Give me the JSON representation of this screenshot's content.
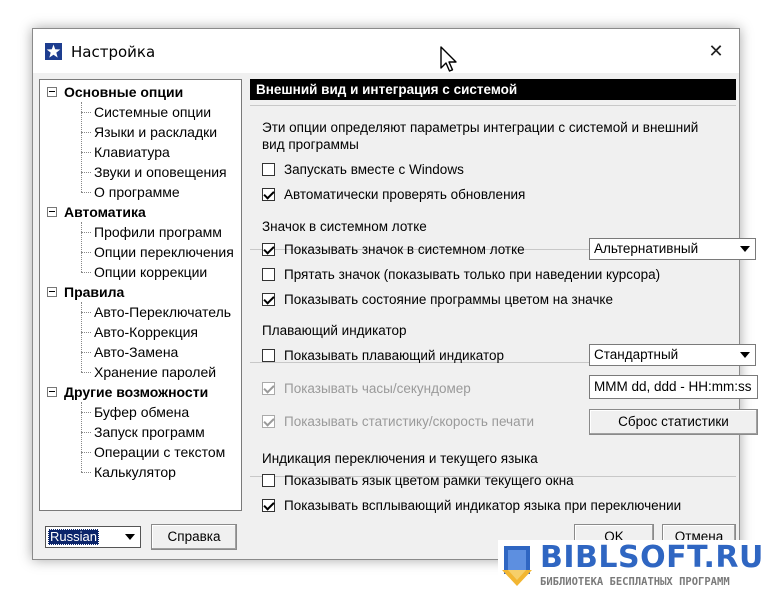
{
  "window": {
    "title": "Настройка",
    "close_glyph": "✕"
  },
  "tree": {
    "groups": [
      {
        "label": "Основные опции",
        "items": [
          "Системные опции",
          "Языки и раскладки",
          "Клавиатура",
          "Звуки и оповещения",
          "О программе"
        ]
      },
      {
        "label": "Автоматика",
        "items": [
          "Профили программ",
          "Опции переключения",
          "Опции коррекции"
        ]
      },
      {
        "label": "Правила",
        "items": [
          "Авто-Переключатель",
          "Авто-Коррекция",
          "Авто-Замена",
          "Хранение паролей"
        ]
      },
      {
        "label": "Другие возможности",
        "items": [
          "Буфер обмена",
          "Запуск программ",
          "Операции с текстом",
          "Калькулятор"
        ]
      }
    ]
  },
  "panel": {
    "header": "Внешний вид и интеграция с системой",
    "description": "Эти опции определяют параметры интеграции с системой и внешний вид программы",
    "general": {
      "start_with_windows": {
        "label": "Запускать вместе с Windows",
        "checked": false
      },
      "auto_update": {
        "label": "Автоматически проверять обновления",
        "checked": true
      }
    },
    "tray": {
      "title": "Значок в системном лотке",
      "show_icon": {
        "label": "Показывать значок в системном лотке",
        "checked": true
      },
      "icon_style": "Альтернативный",
      "hide_icon": {
        "label": "Прятать значок (показывать только при наведении курсора)",
        "checked": false
      },
      "show_state": {
        "label": "Показывать состояние программы цветом на значке",
        "checked": true
      }
    },
    "floating": {
      "title": "Плавающий индикатор",
      "show_indicator": {
        "label": "Показывать плавающий индикатор",
        "checked": false
      },
      "indicator_style": "Стандартный",
      "show_clock": {
        "label": "Показывать часы/секундомер",
        "checked": true
      },
      "clock_format": "MMM dd, ddd - HH:mm:ss",
      "show_stats": {
        "label": "Показывать статистику/скорость печати",
        "checked": true
      },
      "reset_stats_label": "Сброс статистики"
    },
    "lang_indication": {
      "title": "Индикация переключения и текущего языка",
      "frame_color": {
        "label": "Показывать язык цветом рамки текущего окна",
        "checked": false
      },
      "popup": {
        "label": "Показывать всплывающий индикатор языка при переключении",
        "checked": true
      }
    }
  },
  "footer": {
    "language": "Russian",
    "help_label": "Справка",
    "ok_label": "OK",
    "cancel_label": "Отмена"
  },
  "watermark": {
    "title": "BIBLSOFT.RU",
    "subtitle": "БИБЛИОТЕКА БЕСПЛАТНЫХ ПРОГРАММ",
    "color": "#2f66c2"
  },
  "icons": {
    "app": "settings-star-icon",
    "close": "close-icon",
    "dropdown": "chevron-down-icon",
    "cursor": "mouse-pointer-icon"
  }
}
